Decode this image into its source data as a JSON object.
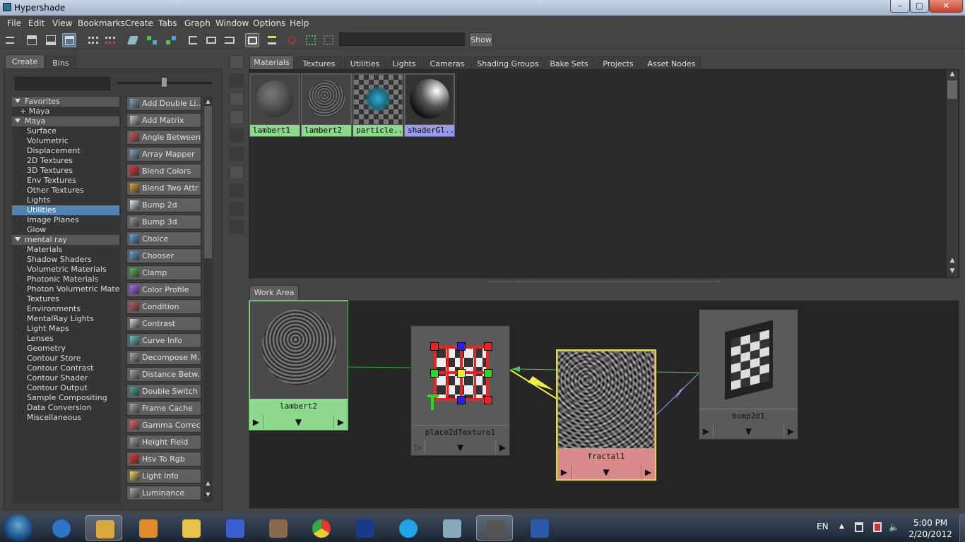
{
  "window": {
    "title": "Hypershade",
    "min": "–",
    "max": "▢",
    "close": "✕"
  },
  "menu": [
    "File",
    "Edit",
    "View",
    "Bookmarks",
    "Create",
    "Tabs",
    "Graph",
    "Window",
    "Options",
    "Help"
  ],
  "toolbar": {
    "show_label": "Show",
    "search_value": ""
  },
  "left_tabs": [
    "Create",
    "Bins"
  ],
  "tree": [
    {
      "label": "Favorites",
      "type": "header"
    },
    {
      "label": "+ Maya",
      "type": "sub"
    },
    {
      "label": "Maya",
      "type": "header"
    },
    {
      "label": "Surface",
      "type": "item"
    },
    {
      "label": "Volumetric",
      "type": "item"
    },
    {
      "label": "Displacement",
      "type": "item"
    },
    {
      "label": "2D Textures",
      "type": "item"
    },
    {
      "label": "3D Textures",
      "type": "item"
    },
    {
      "label": "Env Textures",
      "type": "item"
    },
    {
      "label": "Other Textures",
      "type": "item"
    },
    {
      "label": "Lights",
      "type": "item"
    },
    {
      "label": "Utilities",
      "type": "selected"
    },
    {
      "label": "Image Planes",
      "type": "item"
    },
    {
      "label": "Glow",
      "type": "item"
    },
    {
      "label": "mental ray",
      "type": "header"
    },
    {
      "label": "Materials",
      "type": "item"
    },
    {
      "label": "Shadow Shaders",
      "type": "item"
    },
    {
      "label": "Volumetric Materials",
      "type": "item"
    },
    {
      "label": "Photonic Materials",
      "type": "item"
    },
    {
      "label": "Photon Volumetric Materi...",
      "type": "item"
    },
    {
      "label": "Textures",
      "type": "item"
    },
    {
      "label": "Environments",
      "type": "item"
    },
    {
      "label": "MentalRay Lights",
      "type": "item"
    },
    {
      "label": "Light Maps",
      "type": "item"
    },
    {
      "label": "Lenses",
      "type": "item"
    },
    {
      "label": "Geometry",
      "type": "item"
    },
    {
      "label": "Contour Store",
      "type": "item"
    },
    {
      "label": "Contour Contrast",
      "type": "item"
    },
    {
      "label": "Contour Shader",
      "type": "item"
    },
    {
      "label": "Contour Output",
      "type": "item"
    },
    {
      "label": "Sample Compositing",
      "type": "item"
    },
    {
      "label": "Data Conversion",
      "type": "item"
    },
    {
      "label": "Miscellaneous",
      "type": "item"
    }
  ],
  "nodes": [
    {
      "label": "Add Double Li...",
      "icon": "add-double-linear-icon"
    },
    {
      "label": "Add Matrix",
      "icon": "add-matrix-icon"
    },
    {
      "label": "Angle Between",
      "icon": "angle-between-icon"
    },
    {
      "label": "Array Mapper",
      "icon": "array-mapper-icon"
    },
    {
      "label": "Blend Colors",
      "icon": "blend-colors-icon"
    },
    {
      "label": "Blend Two Attr",
      "icon": "blend-two-attr-icon"
    },
    {
      "label": "Bump 2d",
      "icon": "bump-2d-icon"
    },
    {
      "label": "Bump 3d",
      "icon": "bump-3d-icon"
    },
    {
      "label": "Choice",
      "icon": "choice-icon"
    },
    {
      "label": "Chooser",
      "icon": "chooser-icon"
    },
    {
      "label": "Clamp",
      "icon": "clamp-icon"
    },
    {
      "label": "Color Profile",
      "icon": "color-profile-icon"
    },
    {
      "label": "Condition",
      "icon": "condition-icon"
    },
    {
      "label": "Contrast",
      "icon": "contrast-icon"
    },
    {
      "label": "Curve Info",
      "icon": "curve-info-icon"
    },
    {
      "label": "Decompose M...",
      "icon": "decompose-matrix-icon"
    },
    {
      "label": "Distance Betw...",
      "icon": "distance-between-icon"
    },
    {
      "label": "Double Switch",
      "icon": "double-switch-icon"
    },
    {
      "label": "Frame Cache",
      "icon": "frame-cache-icon"
    },
    {
      "label": "Gamma Correct",
      "icon": "gamma-correct-icon"
    },
    {
      "label": "Height Field",
      "icon": "height-field-icon"
    },
    {
      "label": "Hsv To Rgb",
      "icon": "hsv-to-rgb-icon"
    },
    {
      "label": "Light Info",
      "icon": "light-info-icon"
    },
    {
      "label": "Luminance",
      "icon": "luminance-icon"
    }
  ],
  "top_tabs": [
    "Materials",
    "Textures",
    "Utilities",
    "Lights",
    "Cameras",
    "Shading Groups",
    "Bake Sets",
    "Projects",
    "Asset Nodes"
  ],
  "swatches": [
    {
      "label": "lambert1",
      "color": "#8cd88c"
    },
    {
      "label": "lambert2",
      "color": "#8cd88c"
    },
    {
      "label": "particle...",
      "color": "#8cd88c"
    },
    {
      "label": "shaderGl...",
      "color": "#9a9aee"
    }
  ],
  "work_area": {
    "tab": "Work Area",
    "nodes": [
      {
        "label": "lambert2",
        "color": "#8cd88c"
      },
      {
        "label": "place2dTexture1",
        "color": "#5a5a5a"
      },
      {
        "label": "fractal1",
        "color": "#d98a8a"
      },
      {
        "label": "bump2d1",
        "color": "#5a5a5a"
      }
    ]
  },
  "taskbar": {
    "apps": [
      "start-orb-icon",
      "internet-explorer-icon",
      "explorer-icon",
      "media-player-icon",
      "paint-icon",
      "infinity-icon",
      "tools-icon",
      "chrome-icon",
      "photoshop-icon",
      "skype-icon",
      "desktop-icon",
      "maya-icon",
      "word-icon"
    ],
    "lang": "EN",
    "time": "5:00 PM",
    "date": "2/20/2012"
  }
}
